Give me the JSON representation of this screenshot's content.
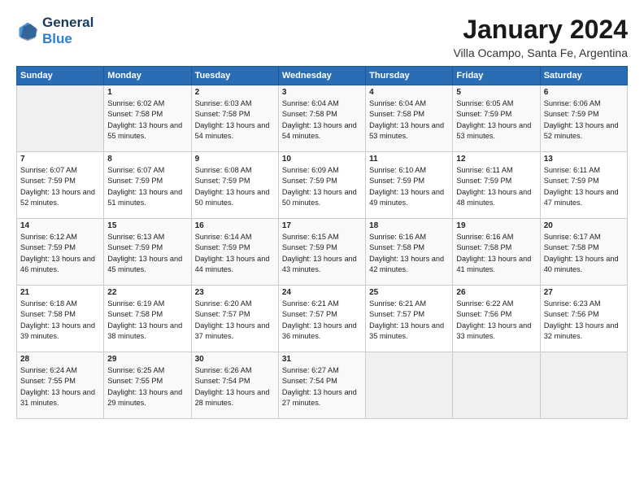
{
  "header": {
    "logo_line1": "General",
    "logo_line2": "Blue",
    "title": "January 2024",
    "subtitle": "Villa Ocampo, Santa Fe, Argentina"
  },
  "days_of_week": [
    "Sunday",
    "Monday",
    "Tuesday",
    "Wednesday",
    "Thursday",
    "Friday",
    "Saturday"
  ],
  "weeks": [
    [
      {
        "day": "",
        "sunrise": "",
        "sunset": "",
        "daylight": ""
      },
      {
        "day": "1",
        "sunrise": "Sunrise: 6:02 AM",
        "sunset": "Sunset: 7:58 PM",
        "daylight": "Daylight: 13 hours and 55 minutes."
      },
      {
        "day": "2",
        "sunrise": "Sunrise: 6:03 AM",
        "sunset": "Sunset: 7:58 PM",
        "daylight": "Daylight: 13 hours and 54 minutes."
      },
      {
        "day": "3",
        "sunrise": "Sunrise: 6:04 AM",
        "sunset": "Sunset: 7:58 PM",
        "daylight": "Daylight: 13 hours and 54 minutes."
      },
      {
        "day": "4",
        "sunrise": "Sunrise: 6:04 AM",
        "sunset": "Sunset: 7:58 PM",
        "daylight": "Daylight: 13 hours and 53 minutes."
      },
      {
        "day": "5",
        "sunrise": "Sunrise: 6:05 AM",
        "sunset": "Sunset: 7:59 PM",
        "daylight": "Daylight: 13 hours and 53 minutes."
      },
      {
        "day": "6",
        "sunrise": "Sunrise: 6:06 AM",
        "sunset": "Sunset: 7:59 PM",
        "daylight": "Daylight: 13 hours and 52 minutes."
      }
    ],
    [
      {
        "day": "7",
        "sunrise": "Sunrise: 6:07 AM",
        "sunset": "Sunset: 7:59 PM",
        "daylight": "Daylight: 13 hours and 52 minutes."
      },
      {
        "day": "8",
        "sunrise": "Sunrise: 6:07 AM",
        "sunset": "Sunset: 7:59 PM",
        "daylight": "Daylight: 13 hours and 51 minutes."
      },
      {
        "day": "9",
        "sunrise": "Sunrise: 6:08 AM",
        "sunset": "Sunset: 7:59 PM",
        "daylight": "Daylight: 13 hours and 50 minutes."
      },
      {
        "day": "10",
        "sunrise": "Sunrise: 6:09 AM",
        "sunset": "Sunset: 7:59 PM",
        "daylight": "Daylight: 13 hours and 50 minutes."
      },
      {
        "day": "11",
        "sunrise": "Sunrise: 6:10 AM",
        "sunset": "Sunset: 7:59 PM",
        "daylight": "Daylight: 13 hours and 49 minutes."
      },
      {
        "day": "12",
        "sunrise": "Sunrise: 6:11 AM",
        "sunset": "Sunset: 7:59 PM",
        "daylight": "Daylight: 13 hours and 48 minutes."
      },
      {
        "day": "13",
        "sunrise": "Sunrise: 6:11 AM",
        "sunset": "Sunset: 7:59 PM",
        "daylight": "Daylight: 13 hours and 47 minutes."
      }
    ],
    [
      {
        "day": "14",
        "sunrise": "Sunrise: 6:12 AM",
        "sunset": "Sunset: 7:59 PM",
        "daylight": "Daylight: 13 hours and 46 minutes."
      },
      {
        "day": "15",
        "sunrise": "Sunrise: 6:13 AM",
        "sunset": "Sunset: 7:59 PM",
        "daylight": "Daylight: 13 hours and 45 minutes."
      },
      {
        "day": "16",
        "sunrise": "Sunrise: 6:14 AM",
        "sunset": "Sunset: 7:59 PM",
        "daylight": "Daylight: 13 hours and 44 minutes."
      },
      {
        "day": "17",
        "sunrise": "Sunrise: 6:15 AM",
        "sunset": "Sunset: 7:59 PM",
        "daylight": "Daylight: 13 hours and 43 minutes."
      },
      {
        "day": "18",
        "sunrise": "Sunrise: 6:16 AM",
        "sunset": "Sunset: 7:58 PM",
        "daylight": "Daylight: 13 hours and 42 minutes."
      },
      {
        "day": "19",
        "sunrise": "Sunrise: 6:16 AM",
        "sunset": "Sunset: 7:58 PM",
        "daylight": "Daylight: 13 hours and 41 minutes."
      },
      {
        "day": "20",
        "sunrise": "Sunrise: 6:17 AM",
        "sunset": "Sunset: 7:58 PM",
        "daylight": "Daylight: 13 hours and 40 minutes."
      }
    ],
    [
      {
        "day": "21",
        "sunrise": "Sunrise: 6:18 AM",
        "sunset": "Sunset: 7:58 PM",
        "daylight": "Daylight: 13 hours and 39 minutes."
      },
      {
        "day": "22",
        "sunrise": "Sunrise: 6:19 AM",
        "sunset": "Sunset: 7:58 PM",
        "daylight": "Daylight: 13 hours and 38 minutes."
      },
      {
        "day": "23",
        "sunrise": "Sunrise: 6:20 AM",
        "sunset": "Sunset: 7:57 PM",
        "daylight": "Daylight: 13 hours and 37 minutes."
      },
      {
        "day": "24",
        "sunrise": "Sunrise: 6:21 AM",
        "sunset": "Sunset: 7:57 PM",
        "daylight": "Daylight: 13 hours and 36 minutes."
      },
      {
        "day": "25",
        "sunrise": "Sunrise: 6:21 AM",
        "sunset": "Sunset: 7:57 PM",
        "daylight": "Daylight: 13 hours and 35 minutes."
      },
      {
        "day": "26",
        "sunrise": "Sunrise: 6:22 AM",
        "sunset": "Sunset: 7:56 PM",
        "daylight": "Daylight: 13 hours and 33 minutes."
      },
      {
        "day": "27",
        "sunrise": "Sunrise: 6:23 AM",
        "sunset": "Sunset: 7:56 PM",
        "daylight": "Daylight: 13 hours and 32 minutes."
      }
    ],
    [
      {
        "day": "28",
        "sunrise": "Sunrise: 6:24 AM",
        "sunset": "Sunset: 7:55 PM",
        "daylight": "Daylight: 13 hours and 31 minutes."
      },
      {
        "day": "29",
        "sunrise": "Sunrise: 6:25 AM",
        "sunset": "Sunset: 7:55 PM",
        "daylight": "Daylight: 13 hours and 29 minutes."
      },
      {
        "day": "30",
        "sunrise": "Sunrise: 6:26 AM",
        "sunset": "Sunset: 7:54 PM",
        "daylight": "Daylight: 13 hours and 28 minutes."
      },
      {
        "day": "31",
        "sunrise": "Sunrise: 6:27 AM",
        "sunset": "Sunset: 7:54 PM",
        "daylight": "Daylight: 13 hours and 27 minutes."
      },
      {
        "day": "",
        "sunrise": "",
        "sunset": "",
        "daylight": ""
      },
      {
        "day": "",
        "sunrise": "",
        "sunset": "",
        "daylight": ""
      },
      {
        "day": "",
        "sunrise": "",
        "sunset": "",
        "daylight": ""
      }
    ]
  ]
}
